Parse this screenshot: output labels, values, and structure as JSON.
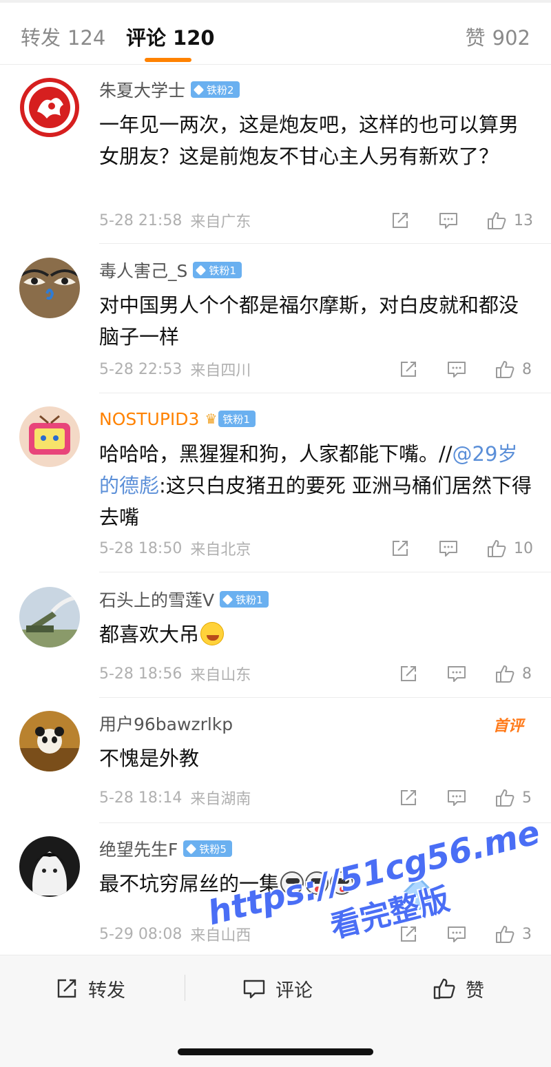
{
  "tabs": {
    "repost_label": "转发",
    "repost_count": "124",
    "comment_label": "评论",
    "comment_count": "120",
    "like_label": "赞",
    "like_count": "902"
  },
  "comments": [
    {
      "username": "朱夏大学士",
      "badge": "铁粉2",
      "text": "一年见一两次，这是炮友吧，这样的也可以算男女朋友？这是前炮友不甘心主人另有新欢了？",
      "time": "5-28 21:58",
      "source": "来自广东",
      "likes": "13"
    },
    {
      "username": "毒人害己_S",
      "badge": "铁粉1",
      "text": "对中国男人个个都是福尔摩斯，对白皮就和都没脑子一样",
      "time": "5-28 22:53",
      "source": "来自四川",
      "likes": "8"
    },
    {
      "username": "NOSTUPID3",
      "badge": "铁粉1",
      "text_before": "哈哈哈，黑猩猩和狗，人家都能下嘴。//",
      "mention": "@29岁的德彪",
      "text_after": ":这只白皮猪丑的要死 亚洲马桶们居然下得去嘴",
      "time": "5-28 18:50",
      "source": "来自北京",
      "likes": "10"
    },
    {
      "username": "石头上的雪莲V",
      "badge": "铁粉1",
      "text": "都喜欢大吊",
      "time": "5-28 18:56",
      "source": "来自山东",
      "likes": "8"
    },
    {
      "username": "用户96bawzrlkp",
      "tag": "首评",
      "text": "不愧是外教",
      "time": "5-28 18:14",
      "source": "来自湖南",
      "likes": "5"
    },
    {
      "username": "绝望先生F",
      "badge": "铁粉5",
      "text": "最不坑穷屌丝的一集",
      "time": "5-29 08:08",
      "source": "来自山西",
      "likes": "3"
    }
  ],
  "bottom_bar": {
    "repost_label": "转发",
    "comment_label": "评论",
    "like_label": "赞"
  },
  "watermark": {
    "line1": "https://51cg56.me",
    "line2": "看完整版"
  },
  "colors": {
    "accent": "#ff8200",
    "mention": "#5b8fd8",
    "badge": "#6ab0f0",
    "watermark": "#4a6ef5"
  }
}
